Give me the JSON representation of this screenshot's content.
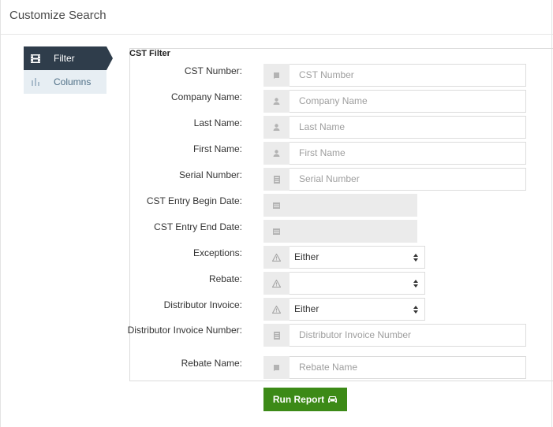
{
  "panel": {
    "title": "Customize Search"
  },
  "sidebar": {
    "items": [
      {
        "label": "Filter",
        "icon": "film-icon",
        "active": true
      },
      {
        "label": "Columns",
        "icon": "columns-icon",
        "active": false
      }
    ]
  },
  "filter": {
    "title": "CST Filter",
    "fields": [
      {
        "label": "CST Number:",
        "type": "text",
        "placeholder": "CST Number",
        "icon": "book-icon"
      },
      {
        "label": "Company Name:",
        "type": "text",
        "placeholder": "Company Name",
        "icon": "user-icon"
      },
      {
        "label": "Last Name:",
        "type": "text",
        "placeholder": "Last Name",
        "icon": "user-icon"
      },
      {
        "label": "First Name:",
        "type": "text",
        "placeholder": "First Name",
        "icon": "user-icon"
      },
      {
        "label": "Serial Number:",
        "type": "text",
        "placeholder": "Serial Number",
        "icon": "barcode-icon"
      },
      {
        "label": "CST Entry Begin Date:",
        "type": "date",
        "value": "",
        "icon": "calendar-icon"
      },
      {
        "label": "CST Entry End Date:",
        "type": "date",
        "value": "",
        "icon": "calendar-icon"
      },
      {
        "label": "Exceptions:",
        "type": "select",
        "value": "Either",
        "icon": "warning-icon"
      },
      {
        "label": "Rebate:",
        "type": "select",
        "value": "",
        "icon": "warning-icon"
      },
      {
        "label": "Distributor Invoice:",
        "type": "select",
        "value": "Either",
        "icon": "warning-icon"
      },
      {
        "label": "Distributor Invoice Number:",
        "type": "text",
        "placeholder": "Distributor Invoice Number",
        "icon": "barcode-icon"
      },
      {
        "label": "Rebate Name:",
        "type": "text",
        "placeholder": "Rebate Name",
        "icon": "book-icon"
      }
    ]
  },
  "actions": {
    "run_label": "Run Report",
    "run_icon": "car-icon"
  },
  "colors": {
    "active_nav": "#2f3d4b",
    "run_button": "#3c8a17",
    "addon_bg": "#ebebeb"
  }
}
